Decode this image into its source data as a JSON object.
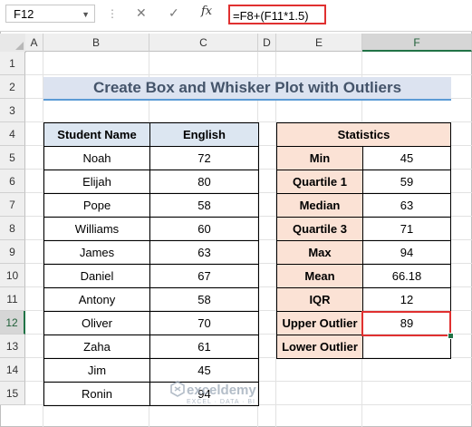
{
  "formula_bar": {
    "name_box": "F12",
    "formula": "=F8+(F11*1.5)",
    "fx_label": "fx"
  },
  "columns": [
    "A",
    "B",
    "C",
    "D",
    "E",
    "F"
  ],
  "rows": [
    "1",
    "2",
    "3",
    "4",
    "5",
    "6",
    "7",
    "8",
    "9",
    "10",
    "11",
    "12",
    "13",
    "14",
    "15"
  ],
  "title": "Create Box and Whisker Plot with Outliers",
  "students": {
    "header_name": "Student Name",
    "header_score": "English",
    "rows": [
      {
        "name": "Noah",
        "score": "72"
      },
      {
        "name": "Elijah",
        "score": "80"
      },
      {
        "name": "Pope",
        "score": "58"
      },
      {
        "name": "Williams",
        "score": "60"
      },
      {
        "name": "James",
        "score": "63"
      },
      {
        "name": "Daniel",
        "score": "67"
      },
      {
        "name": "Antony",
        "score": "58"
      },
      {
        "name": "Oliver",
        "score": "70"
      },
      {
        "name": "Zaha",
        "score": "61"
      },
      {
        "name": "Jim",
        "score": "45"
      },
      {
        "name": "Ronin",
        "score": "94"
      }
    ]
  },
  "statistics": {
    "header": "Statistics",
    "rows": [
      {
        "label": "Min",
        "value": "45"
      },
      {
        "label": "Quartile 1",
        "value": "59"
      },
      {
        "label": "Median",
        "value": "63"
      },
      {
        "label": "Quartile 3",
        "value": "71"
      },
      {
        "label": "Max",
        "value": "94"
      },
      {
        "label": "Mean",
        "value": "66.18"
      },
      {
        "label": "IQR",
        "value": "12"
      },
      {
        "label": "Upper Outlier",
        "value": "89"
      },
      {
        "label": "Lower Outlier",
        "value": ""
      }
    ]
  },
  "watermark": {
    "name": "exceldemy",
    "tagline": "EXCEL · DATA · BI"
  },
  "colors": {
    "accent": "#217346",
    "highlight": "#e03030",
    "title_bg": "#dce3f0",
    "table_header_blue": "#dce6f1",
    "table_header_peach": "#fbe2d5"
  }
}
